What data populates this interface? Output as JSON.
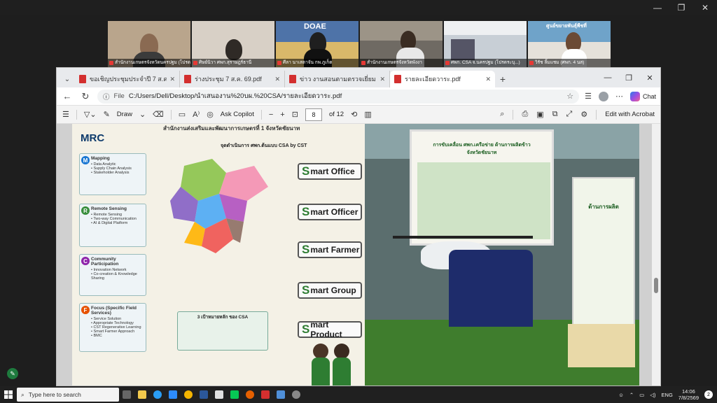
{
  "window_controls": [
    "—",
    "❐",
    "✕"
  ],
  "participants": [
    {
      "name": "สำนักงานเกษตรจังหวัดนครปฐม (โปรดระบุ จังหวัด ...)",
      "bg": "#b9a58c"
    },
    {
      "name": "ศิษย์นิวา ศพก.สุราษฎร์ธานี",
      "bg": "#d8d0c6"
    },
    {
      "name": "ศีลา นาเสตาจัน กพ.ภูเก็ต",
      "bg": "#4e73a8",
      "logo": "DOAE"
    },
    {
      "name": "สำนักงานเกษตรจังหวัดพังงา",
      "bg": "#6f6a63"
    },
    {
      "name": "ศพก. CSA จ.นครปฐม (โปรดระบุ...)",
      "bg": "#c8cfd6"
    },
    {
      "name": "วิรัช ลิ้มแชม (ศพก. 4 นส)",
      "bg": "#6fa3c9",
      "banner": "ศูนย์ขยายพันธุ์พืชที่"
    }
  ],
  "tabs": [
    {
      "label": "ขอเชิญประชุมประจำปี 7 ส.ค. 69 CSA ...",
      "active": false
    },
    {
      "label": "ร่างประชุม 7 ส.ค. 69.pdf",
      "active": false
    },
    {
      "label": "ข่าว งานสอนตามตรวจเยี่ยม 7 ส.ค. 69.pdf",
      "active": false
    },
    {
      "label": "รายละเอียดวาระ.pdf",
      "active": true
    }
  ],
  "address": {
    "prefix": "File",
    "url": "C:/Users/Dell/Desktop/นำเสนองาน%20บผ.%20CSA/รายละเอียดวาระ.pdf"
  },
  "chat_label": "Chat",
  "pdf_toolbar": {
    "draw": "Draw",
    "ask_copilot": "Ask Copilot",
    "page": "8",
    "of_pages": "of 12",
    "edit": "Edit with Acrobat"
  },
  "poster": {
    "header": "สำนักงานส่งเสริมและพัฒนาการเกษตรที่ 1 จังหวัดชัยนาท",
    "brand": "MRC",
    "subtitle": "จุดดำเนินการ ศพก.ต้นแบบ CSA by CST",
    "smart_buttons": [
      "mart Office",
      "mart Officer",
      "mart Farmer",
      "mart Group",
      "mart Product"
    ],
    "side_boxes": [
      {
        "letter": "M",
        "title": "Mapping",
        "lines": [
          "• Data Analytic",
          "• Supply Chain Analysis",
          "• Stakeholder Analysis"
        ],
        "color": "#1976d2"
      },
      {
        "letter": "R",
        "title": "Remote Sensing",
        "lines": [
          "• Remote Sensing",
          "• Two-way Communication",
          "• AI & Digital Platform"
        ],
        "color": "#388e3c"
      },
      {
        "letter": "C",
        "title": "Community Participation",
        "lines": [
          "• Innovation Network",
          "• Co-creation & Knowledge Sharing"
        ],
        "color": "#8e24aa"
      },
      {
        "letter": "F",
        "title": "Focus (Specific Field Services)",
        "lines": [
          "• Service Solution",
          "• Appropriate Technology",
          "• CST Regenerative Learning",
          "• Smart Farmer Approach",
          "• BMC"
        ],
        "color": "#e65100"
      }
    ],
    "goal_title": "3 เป้าหมายหลัก ของ CSA"
  },
  "photo": {
    "banner_title": "การขับเคลื่อน ศพก.เครือข่าย ด้านการผลิตข้าว",
    "banner_sub": "จังหวัดชัยนาท",
    "right_banner": "ด้านการผลิต"
  },
  "taskbar": {
    "search_placeholder": "Type here to search",
    "lang": "ENG",
    "time": "14:06",
    "date": "7/8/2569",
    "notif": "2"
  }
}
